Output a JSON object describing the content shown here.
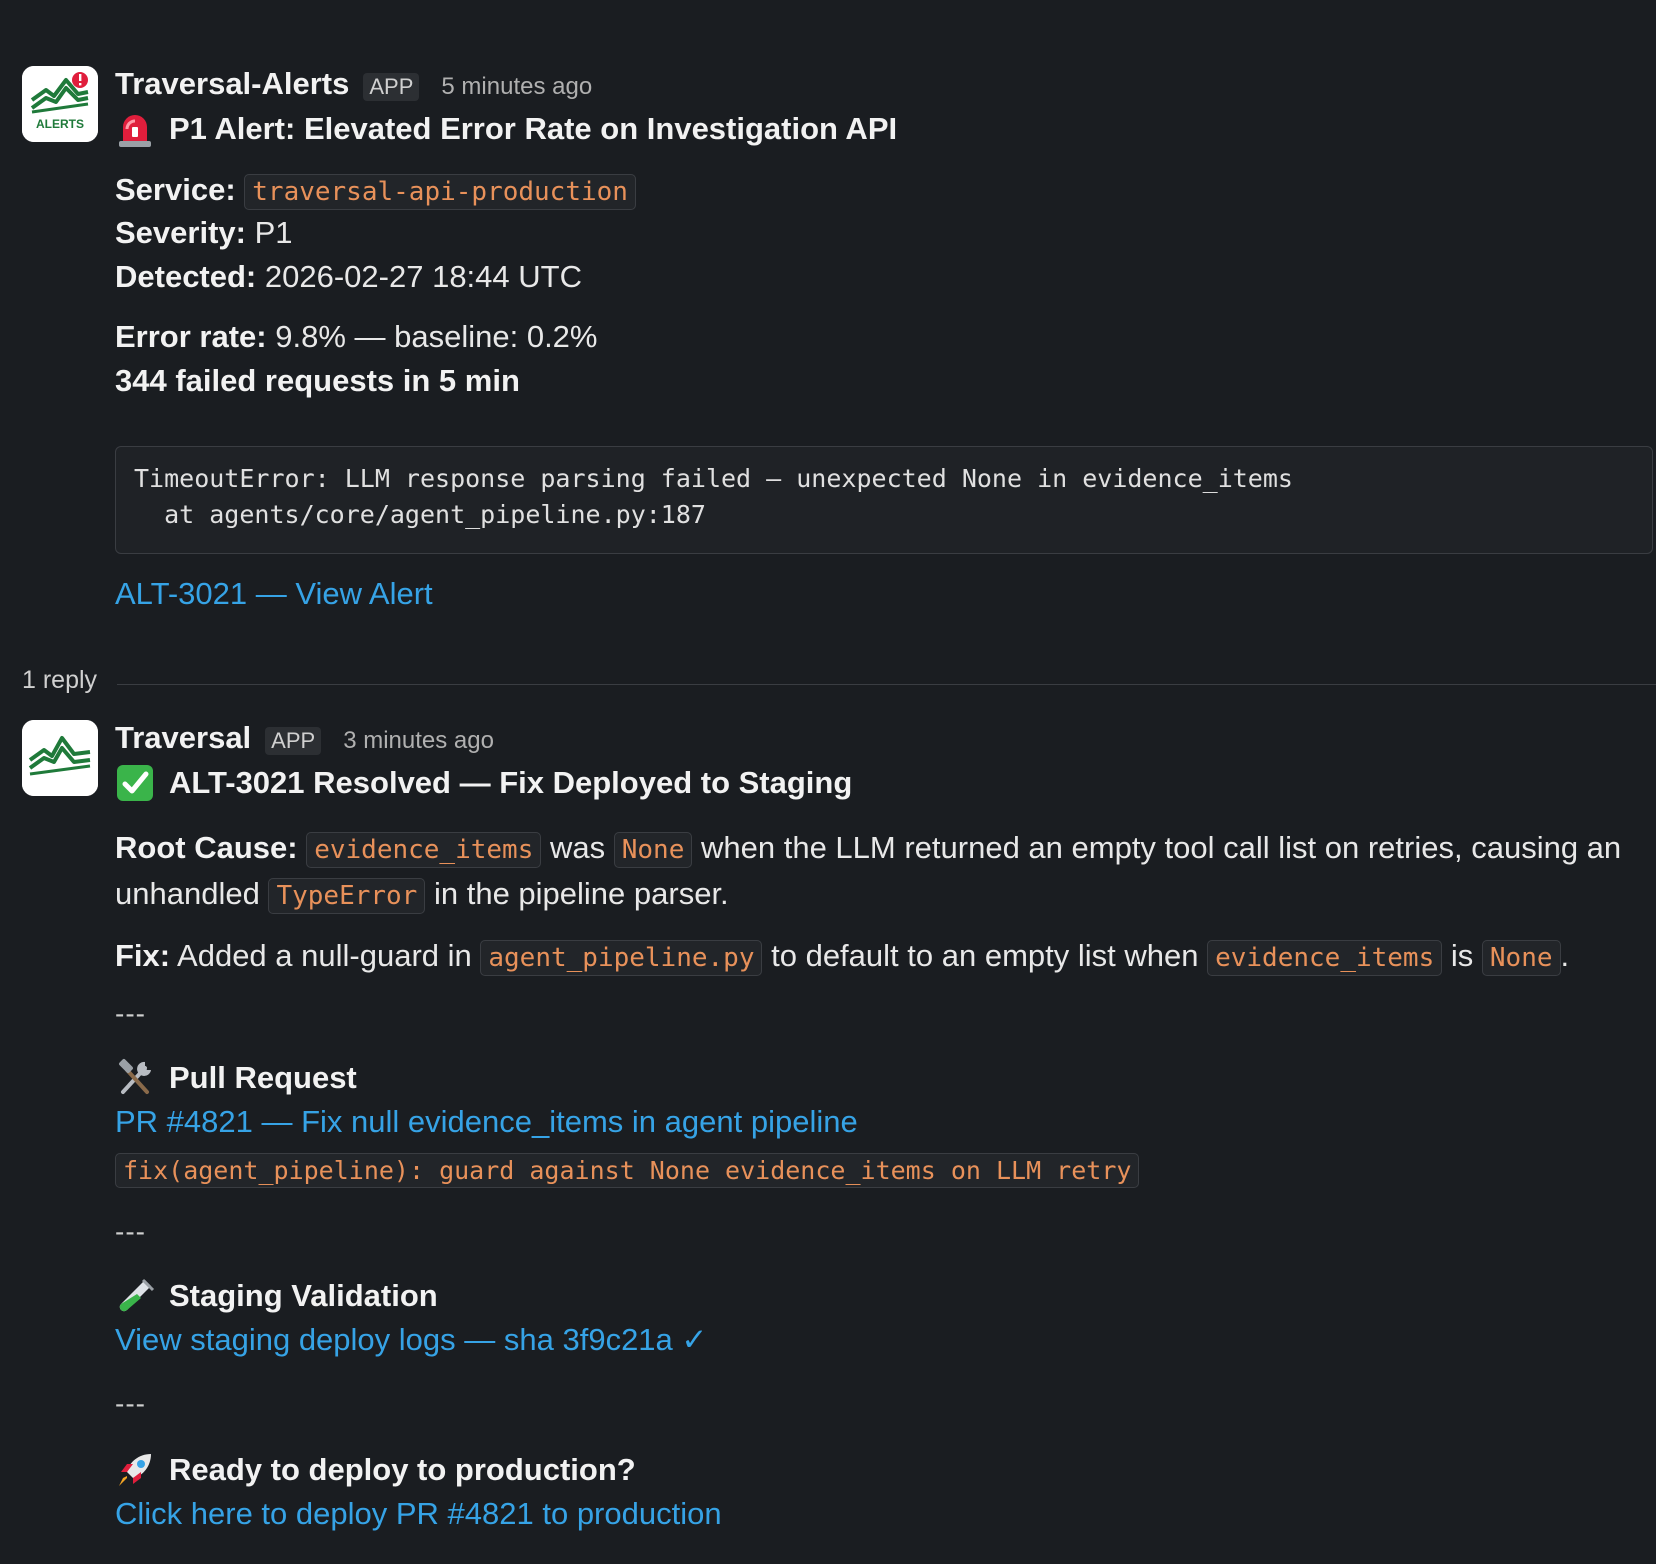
{
  "alert_message": {
    "sender": "Traversal-Alerts",
    "badge": "APP",
    "time": "5 minutes ago",
    "avatar_label": "ALERTS",
    "title": "P1 Alert: Elevated Error Rate on Investigation API",
    "title_icon": "rotating-light-icon",
    "service_label": "Service:",
    "service_value": "traversal-api-production",
    "severity_label": "Severity:",
    "severity_value": "P1",
    "detected_label": "Detected:",
    "detected_value": "2026-02-27 18:44 UTC",
    "error_rate_label": "Error rate:",
    "error_rate_value": "9.8% — baseline: 0.2%",
    "failed_requests": "344 failed requests in 5 min",
    "code_line_1": "TimeoutError: LLM response parsing failed — unexpected None in evidence_items",
    "code_line_2": "  at agents/core/agent_pipeline.py:187",
    "alert_link": "ALT-3021 — View Alert"
  },
  "thread": {
    "reply_count": "1 reply"
  },
  "reply_message": {
    "sender": "Traversal",
    "badge": "APP",
    "time": "3 minutes ago",
    "title": "ALT-3021 Resolved — Fix Deployed to Staging",
    "title_icon": "check-mark-button-icon",
    "root_cause": {
      "label": "Root Cause:",
      "code_1": "evidence_items",
      "text_1": "was",
      "code_2": "None",
      "text_2": "when the LLM returned an empty tool call list on retries, causing an",
      "text_3": "unhandled",
      "code_3": "TypeError",
      "text_4": "in the pipeline parser."
    },
    "fix": {
      "label": "Fix:",
      "text_1": "Added a null-guard in",
      "code_1": "agent_pipeline.py",
      "text_2": "to default to an empty list when",
      "code_2": "evidence_items",
      "text_3": "is",
      "code_3": "None",
      "text_4": "."
    },
    "separator": "---",
    "pull_request": {
      "heading": "Pull Request",
      "icon": "hammer-and-wrench-icon",
      "link": "PR #4821 — Fix null evidence_items in agent pipeline",
      "commit": "fix(agent_pipeline): guard against None evidence_items on LLM retry"
    },
    "staging": {
      "heading": "Staging Validation",
      "icon": "test-tube-icon",
      "link": "View staging deploy logs — sha 3f9c21a ✓"
    },
    "deploy": {
      "heading": "Ready to deploy to production?",
      "icon": "rocket-icon",
      "link": "Click here to deploy PR #4821 to production"
    }
  },
  "colors": {
    "background": "#1a1d21",
    "link": "#36a3e6",
    "code_text": "#e8915a",
    "brand_green": "#1f7a3a",
    "alert_red": "#e01e3c"
  }
}
